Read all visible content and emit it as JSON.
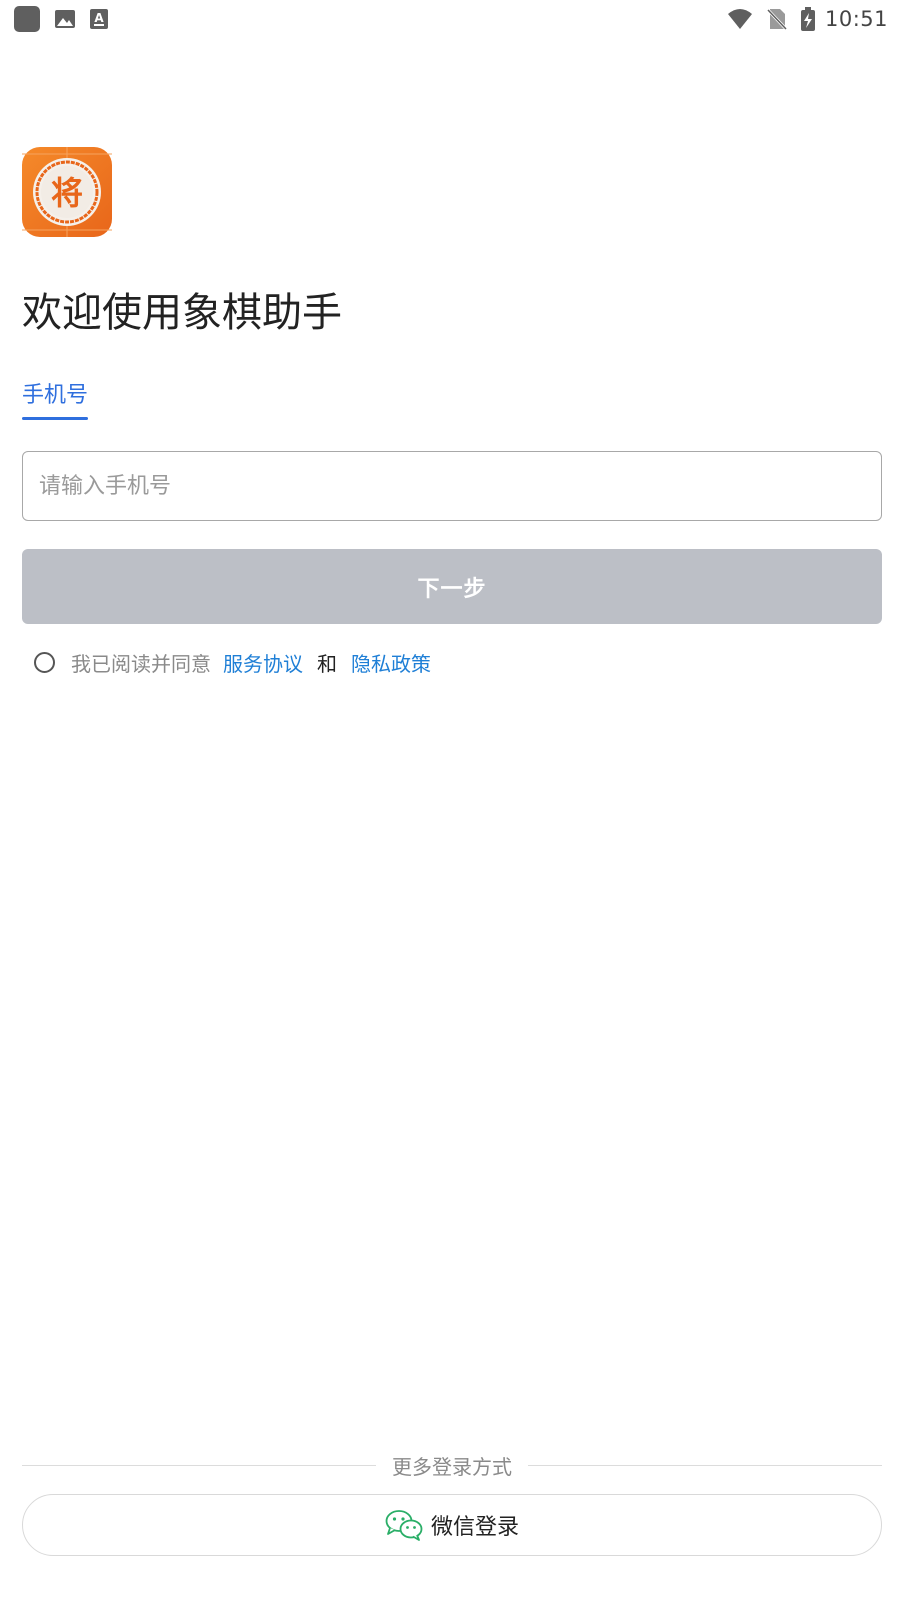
{
  "status_bar": {
    "time": "10:51",
    "left_icons": [
      "app-notification-icon",
      "image-icon",
      "text-a-icon"
    ],
    "right_icons": [
      "wifi-icon",
      "no-sim-icon",
      "battery-charging-icon"
    ]
  },
  "app": {
    "logo_icon": "chess-general-icon",
    "logo_glyph": "将",
    "brand_color": "#f07a22"
  },
  "header": {
    "title": "欢迎使用象棋助手"
  },
  "tabs": [
    {
      "label": "手机号",
      "active": true
    }
  ],
  "login_form": {
    "phone_placeholder": "请输入手机号",
    "phone_value": "",
    "next_label": "下一步",
    "next_enabled": false
  },
  "agreement": {
    "checked": false,
    "prefix": "我已阅读并同意",
    "terms_link": "服务协议",
    "and": "和",
    "privacy_link": "隐私政策"
  },
  "more_login": {
    "label": "更多登录方式",
    "wechat_label": "微信登录",
    "wechat_icon": "wechat-icon"
  },
  "colors": {
    "accent": "#2f6fde",
    "link": "#1f7fd6",
    "button_disabled": "#bcbfc6",
    "wechat_green": "#2aae67"
  }
}
